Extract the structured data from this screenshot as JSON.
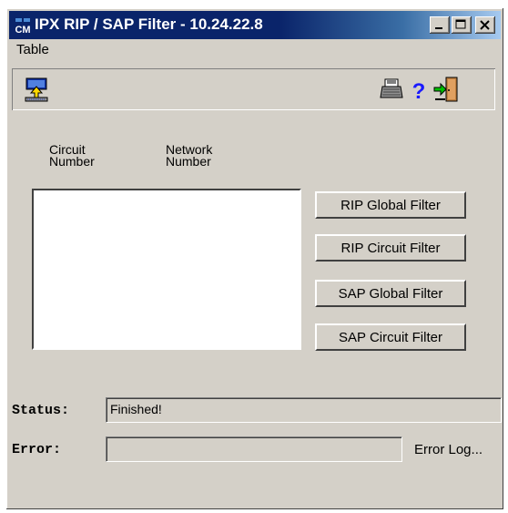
{
  "window": {
    "title": "IPX RIP / SAP Filter - 10.24.22.8",
    "app_icon": "cm-app-icon",
    "controls": [
      "minimize-icon",
      "maximize-icon",
      "close-icon"
    ]
  },
  "menu": {
    "items": [
      {
        "label": "Table"
      }
    ]
  },
  "toolbar": {
    "left": [
      {
        "icon": "upload-icon"
      }
    ],
    "right": [
      {
        "icon": "printer-icon"
      },
      {
        "icon": "help-icon",
        "glyph": "?"
      },
      {
        "icon": "exit-door-icon"
      }
    ]
  },
  "table": {
    "columns": [
      {
        "line1": "Circuit",
        "line2": "Number"
      },
      {
        "line1": "Network",
        "line2": "Number"
      }
    ],
    "rows": []
  },
  "buttons": {
    "rip_global": "RIP Global Filter",
    "rip_circuit": "RIP Circuit Filter",
    "sap_global": "SAP Global Filter",
    "sap_circuit": "SAP Circuit Filter"
  },
  "status": {
    "label": "Status:",
    "value": "Finished!"
  },
  "error": {
    "label": "Error:",
    "value": "",
    "log_label": "Error Log..."
  },
  "colors": {
    "title_bar": "#0a246a",
    "window_bg": "#d4d0c8",
    "help_blue": "#1a1aff"
  }
}
